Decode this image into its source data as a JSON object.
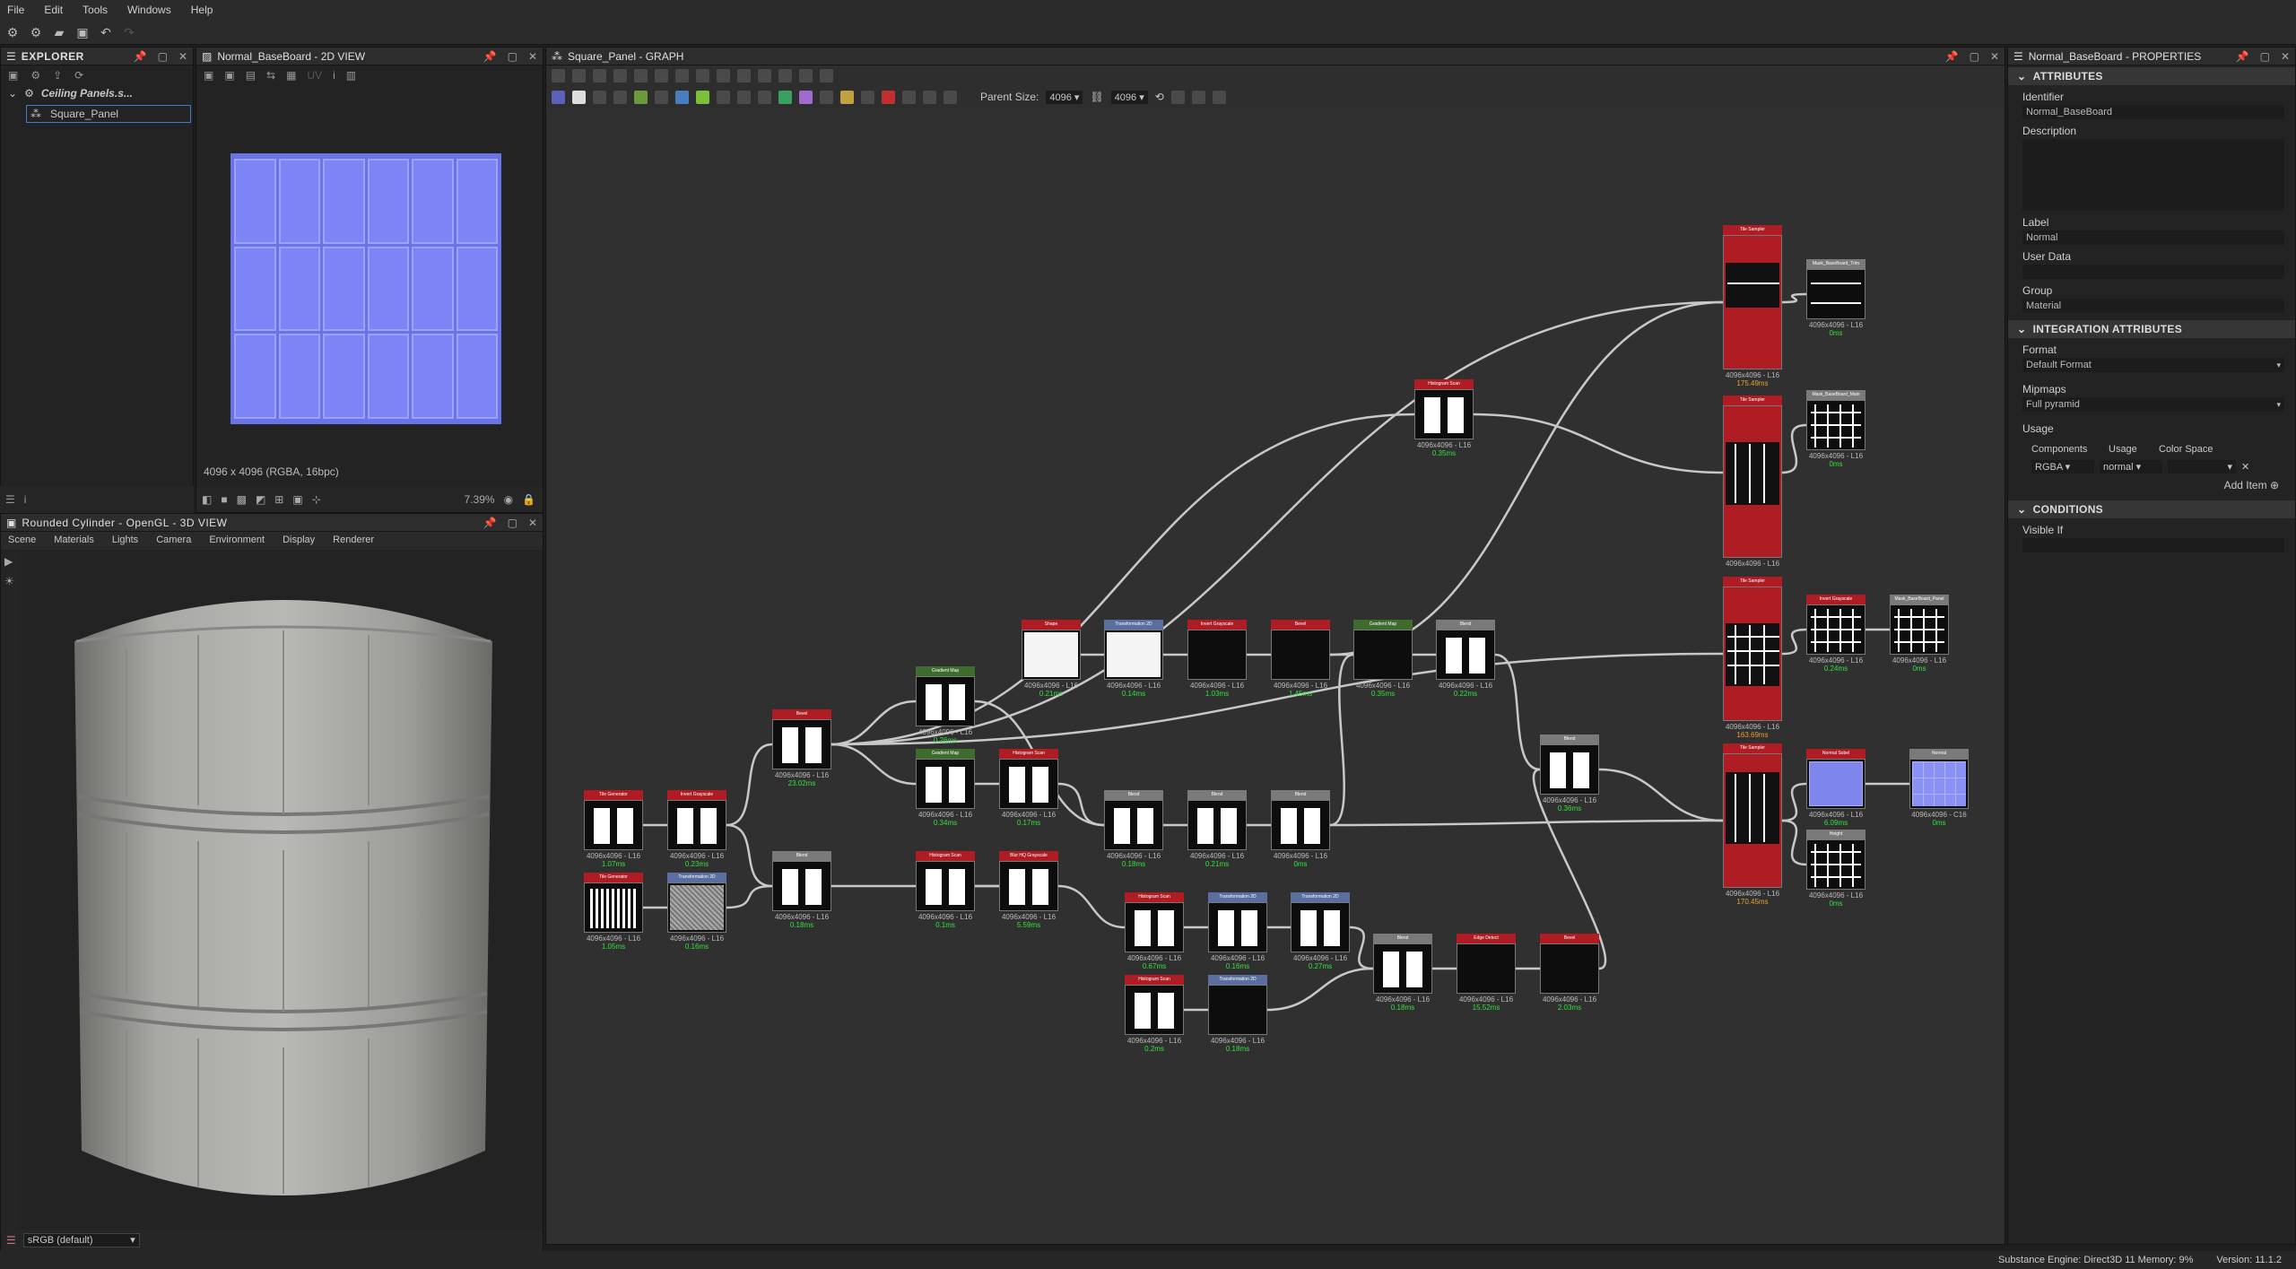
{
  "menu": [
    "File",
    "Edit",
    "Tools",
    "Windows",
    "Help"
  ],
  "explorer": {
    "title": "EXPLORER",
    "package": "Ceiling Panels.s...",
    "graph_item": "Square_Panel"
  },
  "view2d": {
    "title": "Normal_BaseBoard - 2D VIEW",
    "info": "4096 x 4096 (RGBA, 16bpc)",
    "zoom": "7.39%"
  },
  "view3d": {
    "title": "Rounded Cylinder - OpenGL - 3D VIEW",
    "menus": [
      "Scene",
      "Materials",
      "Lights",
      "Camera",
      "Environment",
      "Display",
      "Renderer"
    ],
    "colorspace": "sRGB (default)"
  },
  "graph": {
    "title": "Square_Panel - GRAPH",
    "parent_size_label": "Parent Size:",
    "parent_w": "4096",
    "parent_h": "4096"
  },
  "nodes": [
    {
      "title": "Tile Generator",
      "color": "red",
      "time": "1.07ms",
      "pattern": "cols2"
    },
    {
      "title": "Invert Grayscale",
      "color": "red",
      "time": "0.23ms",
      "pattern": "cols2"
    },
    {
      "title": "Tile Generator",
      "color": "red",
      "time": "1.05ms",
      "pattern": "vlines"
    },
    {
      "title": "Transformation 2D",
      "color": "blu",
      "time": "0.16ms",
      "pattern": "noise"
    },
    {
      "title": "Bevel",
      "color": "red",
      "time": "23.02ms",
      "pattern": "cols2"
    },
    {
      "title": "Blend",
      "color": "gry",
      "time": "0.18ms",
      "pattern": "cols2"
    },
    {
      "title": "Gradient Map",
      "color": "grn",
      "time": "0.26ms",
      "pattern": "cols2"
    },
    {
      "title": "Gradient Map",
      "color": "grn",
      "time": "0.34ms",
      "pattern": "cols2"
    },
    {
      "title": "Histogram Scan",
      "color": "red",
      "time": "0.17ms",
      "pattern": "cols2"
    },
    {
      "title": "Histogram Scan",
      "color": "red",
      "time": "0.1ms",
      "pattern": "cols2"
    },
    {
      "title": "Blur HQ Grayscale",
      "color": "red",
      "time": "5.59ms",
      "pattern": "cols2"
    },
    {
      "title": "Shape",
      "color": "red",
      "time": "0.21ms",
      "pattern": "white"
    },
    {
      "title": "Transformation 2D",
      "color": "blu",
      "time": "0.14ms",
      "pattern": "white"
    },
    {
      "title": "Invert Grayscale",
      "color": "red",
      "time": "1.03ms",
      "pattern": "black"
    },
    {
      "title": "Bevel",
      "color": "red",
      "time": "1.45ms",
      "pattern": "black"
    },
    {
      "title": "Gradient Map",
      "color": "grn",
      "time": "0.35ms",
      "pattern": "black"
    },
    {
      "title": "Blend",
      "color": "gry",
      "time": "0.22ms",
      "pattern": "cols2"
    },
    {
      "title": "Blend",
      "color": "gry",
      "time": "0.18ms",
      "pattern": "cols2"
    },
    {
      "title": "Blend",
      "color": "gry",
      "time": "0.21ms",
      "pattern": "cols2"
    },
    {
      "title": "Blend",
      "color": "gry",
      "time": "0ms",
      "pattern": "cols2"
    },
    {
      "title": "Histogram Scan",
      "color": "red",
      "time": "0.67ms",
      "pattern": "cols2"
    },
    {
      "title": "Transformation 2D",
      "color": "blu",
      "time": "0.16ms",
      "pattern": "cols2"
    },
    {
      "title": "Transformation 2D",
      "color": "blu",
      "time": "0.27ms",
      "pattern": "cols2"
    },
    {
      "title": "Histogram Scan",
      "color": "red",
      "time": "0.2ms",
      "pattern": "cols2"
    },
    {
      "title": "Transformation 2D",
      "color": "blu",
      "time": "0.18ms",
      "pattern": "black"
    },
    {
      "title": "Blend",
      "color": "gry",
      "time": "0.18ms",
      "pattern": "cols2"
    },
    {
      "title": "Edge Detect",
      "color": "red",
      "time": "15.52ms",
      "pattern": "black"
    },
    {
      "title": "Bevel",
      "color": "red",
      "time": "2.03ms",
      "pattern": "black"
    },
    {
      "title": "Histogram Scan",
      "color": "red",
      "time": "0.35ms",
      "pattern": "cols2"
    },
    {
      "title": "Blend",
      "color": "gry",
      "time": "0.36ms",
      "pattern": "cols2"
    },
    {
      "title": "Tile Sampler",
      "color": "red",
      "time": "175.49ms",
      "pattern": "tall1"
    },
    {
      "title": "Tile Sampler",
      "color": "red",
      "time": "",
      "pattern": "tall2"
    },
    {
      "title": "Tile Sampler",
      "color": "red",
      "time": "163.69ms",
      "pattern": "tall3"
    },
    {
      "title": "Tile Sampler",
      "color": "red",
      "time": "170.45ms",
      "pattern": "tall4"
    },
    {
      "title": "Mask_BaseBoard_Trim",
      "color": "gry",
      "time": "0ms",
      "pattern": "hlines"
    },
    {
      "title": "Mask_BaseBoard_Main",
      "color": "gry",
      "time": "0ms",
      "pattern": "grid"
    },
    {
      "title": "Invert Grayscale",
      "color": "red",
      "time": "0.24ms",
      "pattern": "grid"
    },
    {
      "title": "Mask_BaseBoard_Panel",
      "color": "gry",
      "time": "0ms",
      "pattern": "grid"
    },
    {
      "title": "Normal Sobel",
      "color": "red",
      "time": "6.09ms",
      "pattern": "normal"
    },
    {
      "title": "Height",
      "color": "gry",
      "time": "0ms",
      "pattern": "grid"
    },
    {
      "title": "Normal",
      "color": "gry",
      "time": "0ms",
      "pattern": "normal2"
    }
  ],
  "node_size_label": "4096x4096 - L16",
  "node_size_color": "4096x4096 - C16",
  "properties": {
    "title": "Normal_BaseBoard - PROPERTIES",
    "attributes": "ATTRIBUTES",
    "identifier_label": "Identifier",
    "identifier": "Normal_BaseBoard",
    "description_label": "Description",
    "label_label": "Label",
    "label": "Normal",
    "userdata_label": "User Data",
    "group_label": "Group",
    "group": "Material",
    "integration": "INTEGRATION ATTRIBUTES",
    "format_label": "Format",
    "format": "Default Format",
    "mipmaps_label": "Mipmaps",
    "mipmaps": "Full pyramid",
    "usage_label": "Usage",
    "col_components": "Components",
    "col_usage": "Usage",
    "col_colorspace": "Color Space",
    "components": "RGBA",
    "usage": "normal",
    "add_item": "Add Item",
    "conditions": "CONDITIONS",
    "visible_if": "Visible If"
  },
  "status": {
    "engine": "Substance Engine: Direct3D 11 Memory: 9%",
    "version": "Version: 11.1.2"
  }
}
